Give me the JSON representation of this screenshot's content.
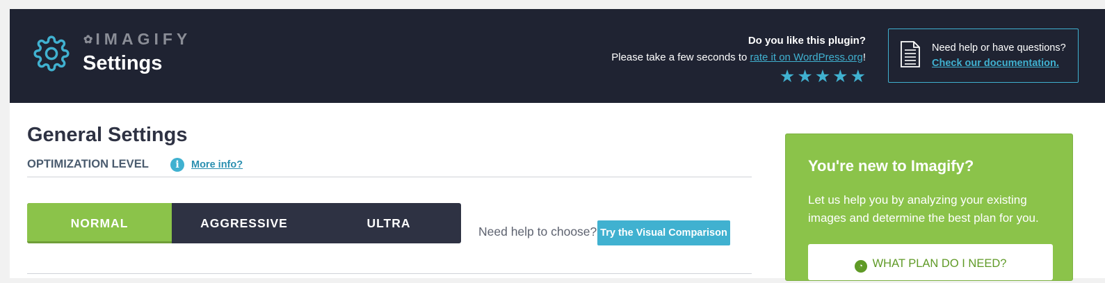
{
  "header": {
    "logo_text": "IMAGIFY",
    "title": "Settings",
    "rate_question": "Do you like this plugin?",
    "rate_prefix": "Please take a few seconds to ",
    "rate_link": "rate it on WordPress.org",
    "rate_suffix": "!",
    "stars": [
      "★",
      "★",
      "★",
      "★",
      "★"
    ],
    "help_text": "Need help or have questions?",
    "help_link": "Check our documentation."
  },
  "general": {
    "heading": "General Settings",
    "optimization_label": "OPTIMIZATION LEVEL",
    "info_icon": "i",
    "more_info": "More info?",
    "levels": [
      "NORMAL",
      "AGGRESSIVE",
      "ULTRA"
    ],
    "selected_level": "NORMAL",
    "need_help": "Need help to choose?",
    "visual_comparison": "Try the Visual Comparison"
  },
  "promo": {
    "heading": "You're new to Imagify?",
    "text": "Let us help you by analyzing your existing images and determine the best plan for you.",
    "button": "WHAT PLAN DO I NEED?"
  },
  "colors": {
    "header_bg": "#1f2332",
    "accent_blue": "#40b1d0",
    "accent_green": "#8bc34a",
    "dark_button": "#2e3243"
  },
  "icons": [
    "gear-icon",
    "imagify-logo-icon",
    "star-icon",
    "document-icon",
    "info-icon",
    "dashboard-icon"
  ]
}
